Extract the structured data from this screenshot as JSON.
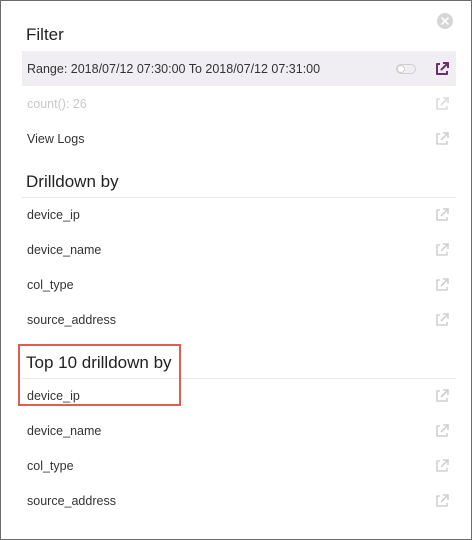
{
  "filter": {
    "title": "Filter",
    "range_label": "Range: 2018/07/12 07:30:00 To 2018/07/12 07:31:00",
    "count_label": "count(): 26",
    "view_logs_label": "View Logs"
  },
  "drilldown": {
    "title": "Drilldown by",
    "items": [
      {
        "label": "device_ip"
      },
      {
        "label": "device_name"
      },
      {
        "label": "col_type"
      },
      {
        "label": "source_address"
      }
    ]
  },
  "top_drilldown": {
    "title": "Top 10 drilldown by",
    "items": [
      {
        "label": "device_ip"
      },
      {
        "label": "device_name"
      },
      {
        "label": "col_type"
      },
      {
        "label": "source_address"
      }
    ]
  },
  "colors": {
    "accent": "#6a2d6f",
    "highlight_bg": "#f0eef2",
    "icon_muted": "#d0d0d0",
    "annotation": "#e25c52"
  },
  "icons": {
    "close": "close-icon",
    "external": "external-link-icon",
    "toggle": "toggle-switch-icon"
  }
}
